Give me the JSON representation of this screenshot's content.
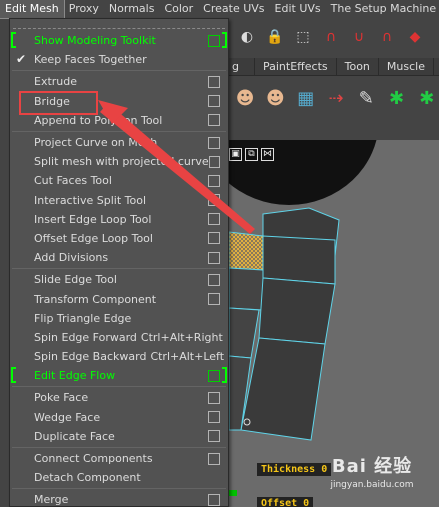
{
  "menubar": {
    "items": [
      "Edit Mesh",
      "Proxy",
      "Normals",
      "Color",
      "Create UVs",
      "Edit UVs",
      "The Setup Machine"
    ],
    "active_index": 0
  },
  "shelf": {
    "tabs": [
      "g",
      "PaintEffects",
      "Toon",
      "Muscle"
    ]
  },
  "dropdown": {
    "items": [
      {
        "label": "Show Modeling Toolkit",
        "style": "green-bracket",
        "option": true
      },
      {
        "label": "Keep Faces Together",
        "checked": true,
        "option": false
      },
      {
        "separator": true
      },
      {
        "label": "Extrude",
        "option": true
      },
      {
        "label": "Bridge",
        "option": true
      },
      {
        "label": "Append to Polygon Tool",
        "option": true
      },
      {
        "separator": true
      },
      {
        "label": "Project Curve on Mesh",
        "option": true
      },
      {
        "label": "Split mesh with projected curve",
        "option": true
      },
      {
        "label": "Cut Faces Tool",
        "option": true
      },
      {
        "label": "Interactive Split Tool",
        "option": true
      },
      {
        "label": "Insert Edge Loop Tool",
        "option": true
      },
      {
        "label": "Offset Edge Loop Tool",
        "option": true
      },
      {
        "label": "Add Divisions",
        "option": true
      },
      {
        "separator": true
      },
      {
        "label": "Slide Edge Tool",
        "option": true
      },
      {
        "label": "Transform Component",
        "option": true
      },
      {
        "label": "Flip Triangle Edge",
        "option": false
      },
      {
        "label": "Spin Edge Forward",
        "shortcut": "Ctrl+Alt+Right",
        "option": false
      },
      {
        "label": "Spin Edge Backward",
        "shortcut": "Ctrl+Alt+Left",
        "option": false
      },
      {
        "label": "Edit Edge Flow",
        "style": "green-bracket",
        "option": true
      },
      {
        "separator": true
      },
      {
        "label": "Poke Face",
        "option": true
      },
      {
        "label": "Wedge Face",
        "option": true
      },
      {
        "label": "Duplicate Face",
        "option": true
      },
      {
        "separator": true
      },
      {
        "label": "Connect Components",
        "option": true
      },
      {
        "label": "Detach Component",
        "option": false
      },
      {
        "separator": true
      },
      {
        "label": "Merge",
        "option": true
      }
    ]
  },
  "viewport": {
    "hud_thickness": "Thickness  0",
    "hud_offset": "Offset  0"
  },
  "watermark": {
    "logo": "Bai 经验",
    "url": "jingyan.baidu.com"
  },
  "colors": {
    "menu_bg": "#525252",
    "highlight_green": "#00ff00",
    "annotation_red": "#e84343",
    "selection_cyan": "#5fd3e8"
  }
}
